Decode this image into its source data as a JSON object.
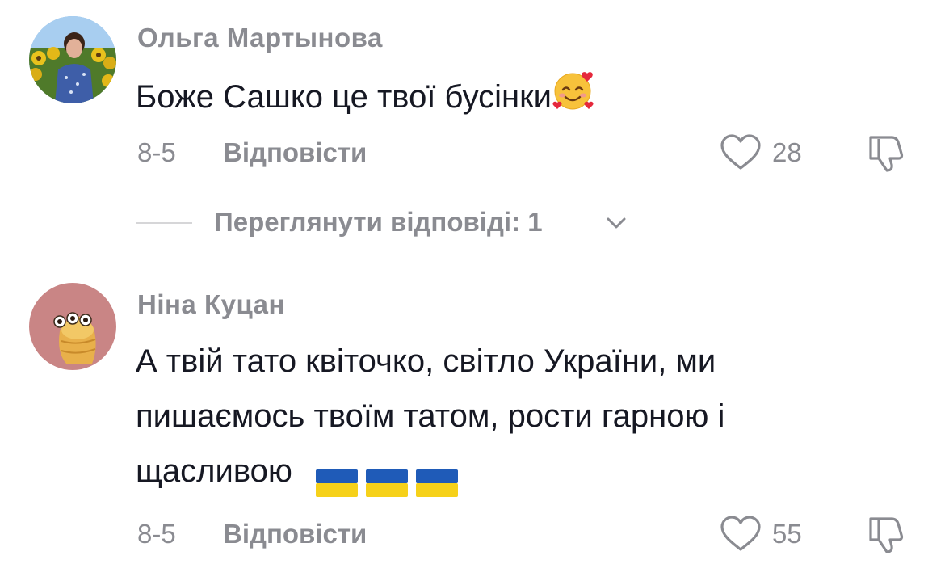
{
  "comments": [
    {
      "username": "Ольга Мартынова",
      "text": "Боже Сашко це твої бусінки",
      "text_emoji": "smiling-face-with-hearts-icon",
      "date": "8-5",
      "reply_label": "Відповісти",
      "likes": "28",
      "view_replies_label": "Переглянути відповіді: 1"
    },
    {
      "username": "Ніна Куцан",
      "text_lines": [
        "А твій тато квіточко, світло України, ми",
        "пишаємось твоїм татом, рости гарною і",
        "щасливою"
      ],
      "text_emojis": [
        "ukraine-flag-icon",
        "ukraine-flag-icon",
        "ukraine-flag-icon"
      ],
      "date": "8-5",
      "reply_label": "Відповісти",
      "likes": "55"
    }
  ],
  "colors": {
    "text_primary": "#161823",
    "text_secondary": "#8a8b91",
    "flag_blue": "#1f5bb8",
    "flag_yellow": "#f6d11a",
    "avatar2_bg": "#c98585"
  }
}
